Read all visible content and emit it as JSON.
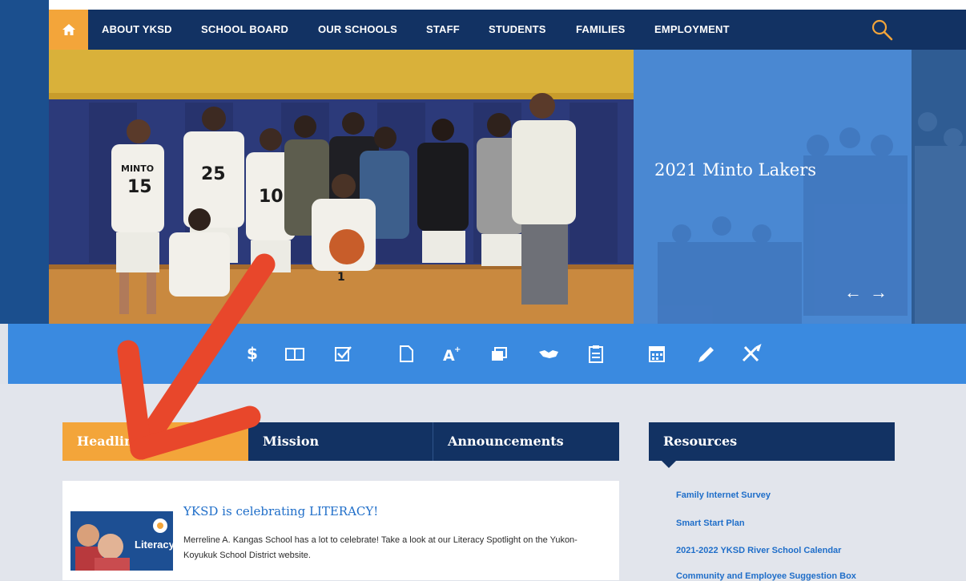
{
  "nav": {
    "home_icon": "home-icon",
    "items": [
      "ABOUT YKSD",
      "SCHOOL BOARD",
      "OUR SCHOOLS",
      "STAFF",
      "STUDENTS",
      "FAMILIES",
      "EMPLOYMENT"
    ],
    "search_icon": "search-icon"
  },
  "hero": {
    "title": "2021 Minto Lakers",
    "prev_label": "←",
    "next_label": "→",
    "jerseys": [
      "MINTO",
      "15",
      "25",
      "10",
      "1"
    ]
  },
  "quick_links": {
    "icons": [
      "dollar-icon",
      "book-icon",
      "checkbox-icon",
      "document-icon",
      "grades-icon",
      "books-icon",
      "handshake-icon",
      "clipboard-icon",
      "calendar-icon",
      "pencil-icon",
      "tools-icon"
    ]
  },
  "tabs": [
    "Headlines",
    "Mission",
    "Announcements"
  ],
  "headline": {
    "title": "YKSD is celebrating LITERACY!",
    "body": "Merreline A. Kangas School has a lot to celebrate! Take a look at our Literacy Spotlight on the Yukon-Koyukuk School District website.",
    "thumb_label": "Literacy"
  },
  "resources": {
    "title": "Resources",
    "links": [
      "Family Internet Survey",
      "Smart Start Plan",
      "2021-2022 YKSD River School Calendar",
      "Community and Employee Suggestion Box"
    ]
  },
  "colors": {
    "navy": "#123263",
    "orange": "#f3a53a",
    "blue": "#3a8ae0",
    "link": "#1f6ec9",
    "annotation_red": "#e8472b"
  }
}
